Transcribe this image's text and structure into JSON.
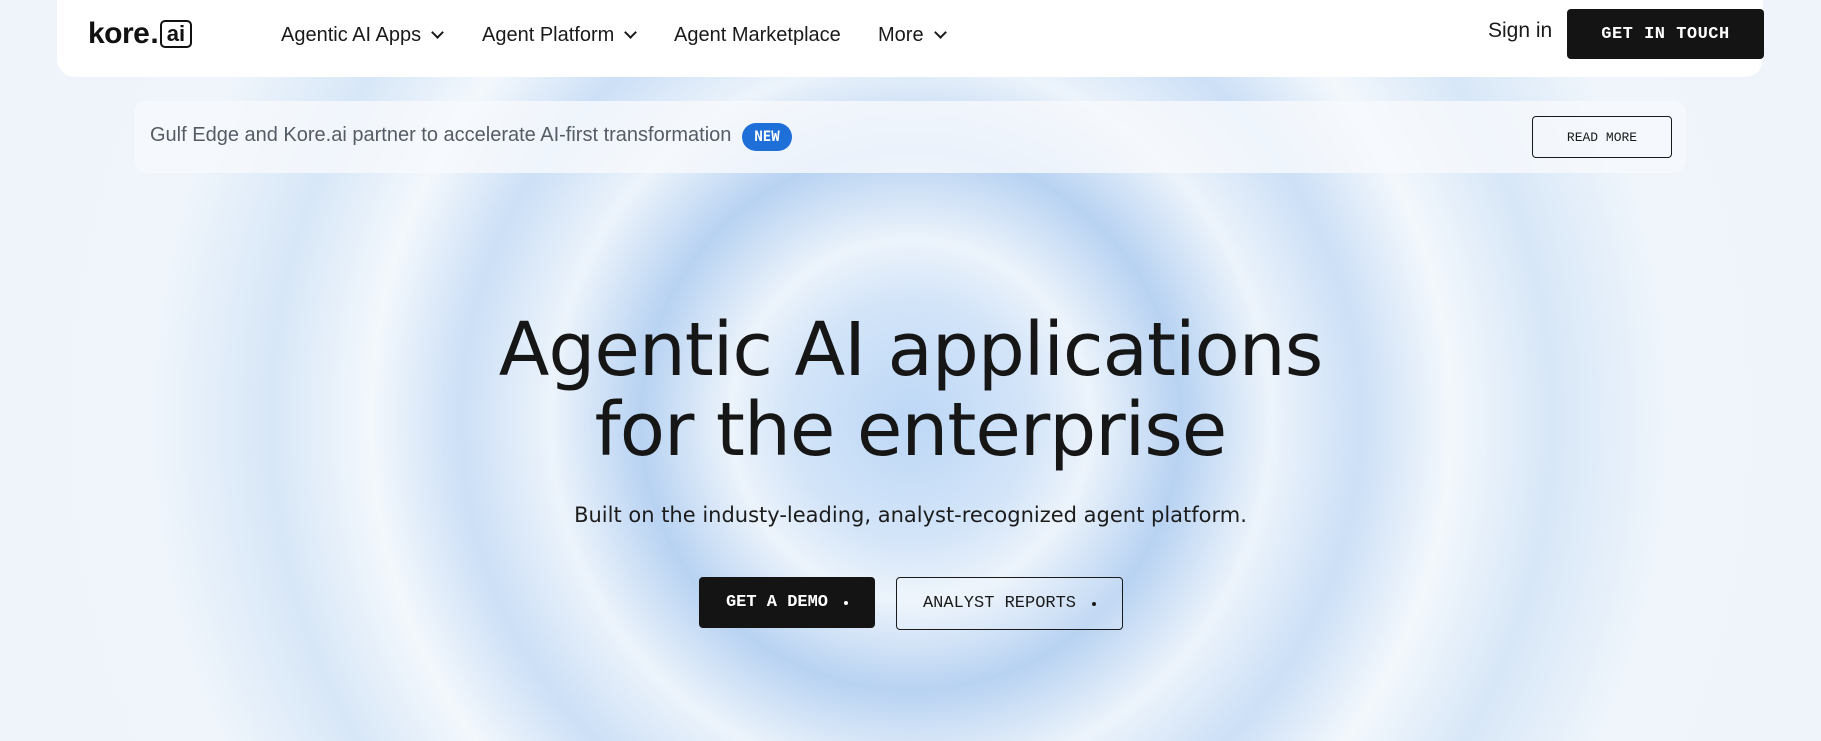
{
  "header": {
    "logo": {
      "main": "kore",
      "dot": ".",
      "box": "ai"
    },
    "nav": [
      {
        "label": "Agentic AI Apps",
        "has_dropdown": true
      },
      {
        "label": "Agent Platform",
        "has_dropdown": true
      },
      {
        "label": "Agent Marketplace",
        "has_dropdown": false
      },
      {
        "label": "More",
        "has_dropdown": true
      }
    ],
    "sign_in": "Sign in",
    "cta": "GET IN TOUCH"
  },
  "banner": {
    "text": "Gulf Edge and Kore.ai partner to accelerate AI-first transformation",
    "badge": "NEW",
    "badge_color": "#1f6fd8",
    "button": "READ MORE"
  },
  "hero": {
    "title_line1": "Agentic AI applications",
    "title_line2": "for the enterprise",
    "subtitle": "Built on the industy-leading, analyst-recognized agent platform.",
    "primary_button": "GET A DEMO",
    "secondary_button": "ANALYST REPORTS"
  },
  "colors": {
    "dark": "#141414",
    "background": "#eef4fa",
    "accent_blue": "#1f6fd8"
  }
}
